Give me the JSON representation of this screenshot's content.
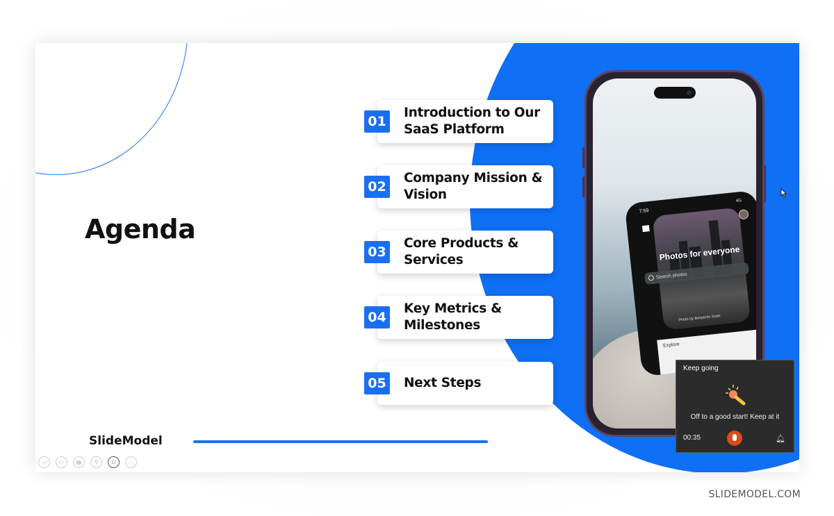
{
  "slide": {
    "title": "Agenda",
    "brand": "SlideModel",
    "agenda": [
      {
        "number": "01",
        "label": "Introduction to Our SaaS Platform"
      },
      {
        "number": "02",
        "label": "Company Mission & Vision"
      },
      {
        "number": "03",
        "label": "Core Products & Services"
      },
      {
        "number": "04",
        "label": "Key Metrics & Milestones"
      },
      {
        "number": "05",
        "label": "Next Steps"
      }
    ],
    "accent_color": "#1a6ff0"
  },
  "phone_screen": {
    "time": "7:59",
    "signal": "4G",
    "headline": "Photos for everyone",
    "search_placeholder": "Search photos",
    "credit": "Photo by Benjamin Suter",
    "explore": "Explore"
  },
  "presenter_controls": {
    "buttons": [
      "previous",
      "next",
      "slides",
      "zoom",
      "camera",
      "more"
    ]
  },
  "toast": {
    "title": "Keep going",
    "message": "Off to a good start! Keep at it",
    "timer": "00:35"
  },
  "watermark": "SLIDEMODEL.COM"
}
